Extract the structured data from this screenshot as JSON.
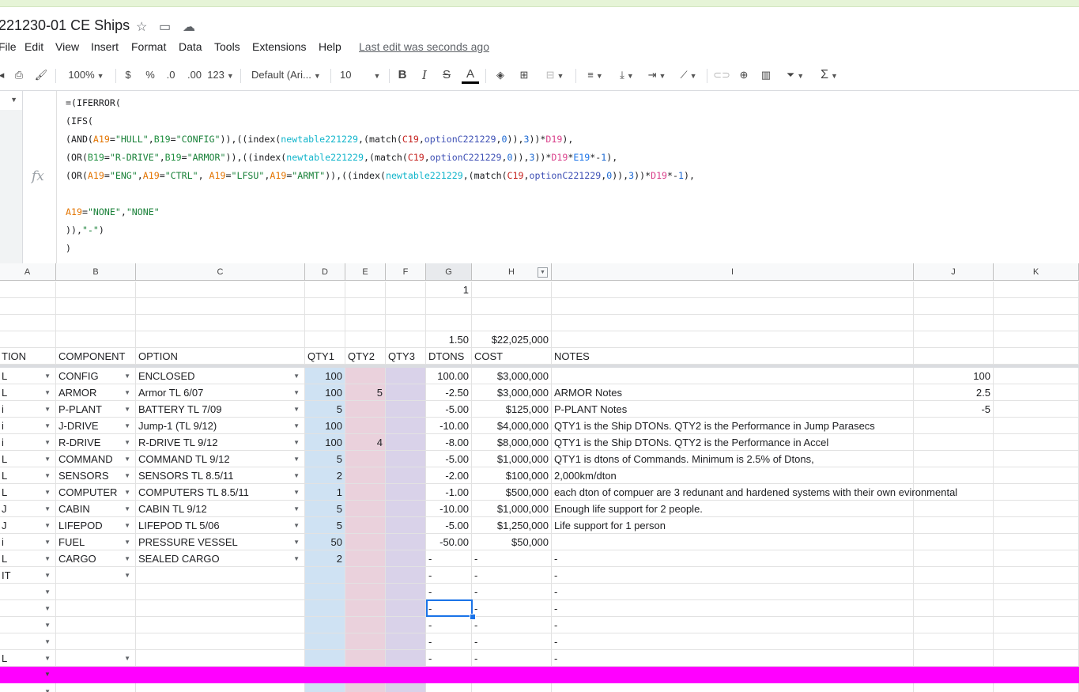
{
  "doc": {
    "title": "221230-01 CE Ships"
  },
  "menu": [
    "File",
    "Edit",
    "View",
    "Insert",
    "Format",
    "Data",
    "Tools",
    "Extensions",
    "Help"
  ],
  "last_edit": "Last edit was seconds ago",
  "toolbar": {
    "zoom": "100%",
    "currency": "$",
    "percent": "%",
    "dec_decrease": ".0",
    "dec_increase": ".00",
    "number_format": "123",
    "font": "Default (Ari...",
    "font_size": "10",
    "bold": "B",
    "italic": "I",
    "strike": "S",
    "text_color": "A"
  },
  "formula_lines": [
    "=(IFERROR(",
    "(IFS(",
    "(AND(A19=\"HULL\",B19=\"CONFIG\")),((index(newtable221229,(match(C19,optionC221229,0)),3))*D19),",
    "(OR(B19=\"R-DRIVE\",B19=\"ARMOR\")),((index(newtable221229,(match(C19,optionC221229,0)),3))*D19*E19*-1),",
    "(OR(A19=\"ENG\",A19=\"CTRL\", A19=\"LFSU\",A19=\"ARMT\")),((index(newtable221229,(match(C19,optionC221229,0)),3))*D19*-1),",
    "",
    "A19=\"NONE\",\"NONE\"",
    ")),\"-\")",
    ")"
  ],
  "columns": [
    "A",
    "B",
    "C",
    "D",
    "E",
    "F",
    "G",
    "H",
    "I",
    "J",
    "K"
  ],
  "top_rows": {
    "g1": "1",
    "g4": "1.50",
    "h4": "$22,025,000"
  },
  "headers": {
    "a": "TION",
    "b": "COMPONENT",
    "c": "OPTION",
    "d": "QTY1",
    "e": "QTY2",
    "f": "QTY3",
    "g": "DTONS",
    "h": "COST",
    "i": "NOTES"
  },
  "rows": [
    {
      "a": "L",
      "b": "CONFIG",
      "c": "ENCLOSED",
      "d": "100",
      "e": "",
      "g": "100.00",
      "h": "$3,000,000",
      "i": "",
      "j": "100"
    },
    {
      "a": "L",
      "b": "ARMOR",
      "c": "Armor TL 6/07",
      "d": "100",
      "e": "5",
      "g": "-2.50",
      "h": "$3,000,000",
      "i": "ARMOR Notes",
      "j": "2.5"
    },
    {
      "a": "i",
      "b": "P-PLANT",
      "c": "BATTERY TL 7/09",
      "d": "5",
      "e": "",
      "g": "-5.00",
      "h": "$125,000",
      "i": "P-PLANT Notes",
      "j": "-5"
    },
    {
      "a": "i",
      "b": "J-DRIVE",
      "c": "Jump-1 (TL 9/12)",
      "d": "100",
      "e": "",
      "g": "-10.00",
      "h": "$4,000,000",
      "i": "QTY1 is the Ship DTONs. QTY2 is the Performance in Jump Parasecs",
      "j": ""
    },
    {
      "a": "i",
      "b": "R-DRIVE",
      "c": "R-DRIVE TL 9/12",
      "d": "100",
      "e": "4",
      "g": "-8.00",
      "h": "$8,000,000",
      "i": "QTY1 is the Ship DTONs. QTY2 is the Performance in Accel",
      "j": ""
    },
    {
      "a": "L",
      "b": "COMMAND",
      "c": "COMMAND TL 9/12",
      "d": "5",
      "e": "",
      "g": "-5.00",
      "h": "$1,000,000",
      "i": "QTY1 is dtons of Commands. Minimum is 2.5% of Dtons,",
      "j": ""
    },
    {
      "a": "L",
      "b": "SENSORS",
      "c": "SENSORS TL 8.5/11",
      "d": "2",
      "e": "",
      "g": "-2.00",
      "h": "$100,000",
      "i": "2,000km/dton",
      "j": ""
    },
    {
      "a": "L",
      "b": "COMPUTER",
      "c": "COMPUTERS TL 8.5/11",
      "d": "1",
      "e": "",
      "g": "-1.00",
      "h": "$500,000",
      "i": "each dton of compuer are 3 redunant and hardened systems with their own evironmental",
      "j": ""
    },
    {
      "a": "J",
      "b": "CABIN",
      "c": "CABIN TL 9/12",
      "d": "5",
      "e": "",
      "g": "-10.00",
      "h": "$1,000,000",
      "i": "Enough life support for 2 people.",
      "j": ""
    },
    {
      "a": "J",
      "b": "LIFEPOD",
      "c": "LIFEPOD TL 5/06",
      "d": "5",
      "e": "",
      "g": "-5.00",
      "h": "$1,250,000",
      "i": "Life support for 1 person",
      "j": ""
    },
    {
      "a": "i",
      "b": "FUEL",
      "c": "PRESSURE VESSEL",
      "d": "50",
      "e": "",
      "g": "-50.00",
      "h": "$50,000",
      "i": "",
      "j": ""
    },
    {
      "a": "L",
      "b": "CARGO",
      "c": "SEALED CARGO",
      "d": "2",
      "e": "",
      "g": "-",
      "h": "-",
      "i": "-",
      "j": ""
    },
    {
      "a": "IT",
      "b": "",
      "c": "",
      "d": "",
      "e": "",
      "g": "-",
      "h": "-",
      "i": "-",
      "j": ""
    },
    {
      "a": "",
      "b": "",
      "c": "",
      "d": "",
      "e": "",
      "g": "-",
      "h": "-",
      "i": "-",
      "j": ""
    },
    {
      "a": "",
      "b": "",
      "c": "",
      "d": "",
      "e": "",
      "g": "-",
      "h": "-",
      "i": "-",
      "j": ""
    },
    {
      "a": "",
      "b": "",
      "c": "",
      "d": "",
      "e": "",
      "g": "-",
      "h": "-",
      "i": "-",
      "j": ""
    },
    {
      "a": "",
      "b": "",
      "c": "",
      "d": "",
      "e": "",
      "g": "-",
      "h": "-",
      "i": "-",
      "j": ""
    },
    {
      "a": "L",
      "b": "",
      "c": "",
      "d": "",
      "e": "",
      "g": "-",
      "h": "-",
      "i": "-",
      "j": ""
    }
  ],
  "colors": {
    "qty1": "#cfe2f3",
    "qty2": "#ead1dc",
    "qty3": "#d9d2e9",
    "highlight_row": "#ff00ff",
    "selection": "#1a73e8"
  }
}
